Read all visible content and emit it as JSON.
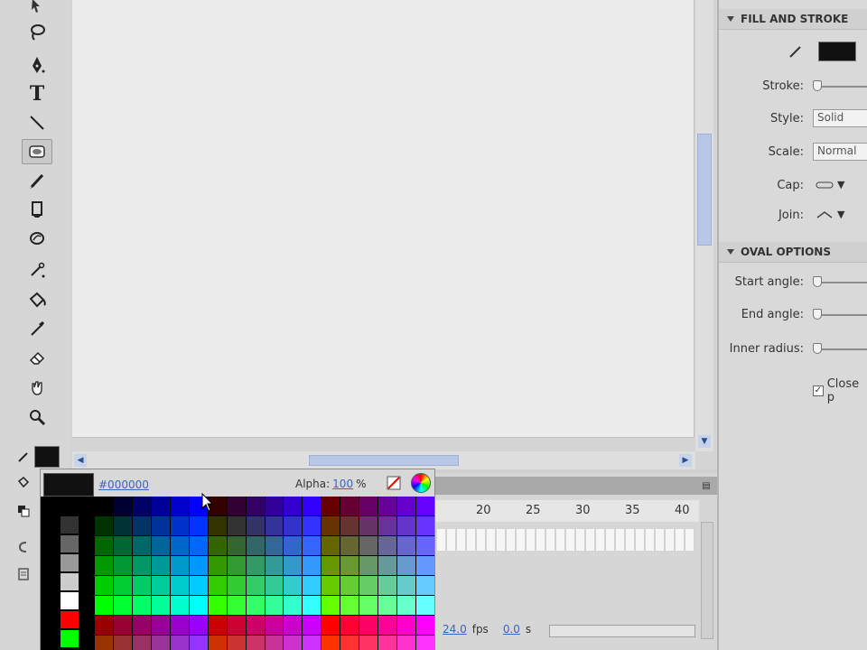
{
  "toolbar": {
    "tools": [
      "lasso-tool",
      "pen-tool",
      "text-tool",
      "line-tool",
      "oval-tool",
      "pencil-tool",
      "brush-tool",
      "deco-tool",
      "bone-tool",
      "paint-bucket-tool",
      "eyedropper-tool",
      "eraser-tool",
      "hand-tool",
      "zoom-tool"
    ],
    "text_tool_glyph": "T",
    "stroke_color": "#111111",
    "selected_tool": "oval-tool"
  },
  "swatch_popup": {
    "hex": "#000000",
    "alpha_label": "Alpha:",
    "alpha_value": "100",
    "alpha_unit": "%",
    "left_column": [
      "#000000",
      "#333333",
      "#666666",
      "#999999",
      "#cccccc",
      "#ffffff",
      "#ff0000",
      "#00ff00"
    ]
  },
  "timeline": {
    "ruler_numbers": [
      "20",
      "25",
      "30",
      "35",
      "40"
    ],
    "fps_value": "24.0",
    "fps_unit": "fps",
    "time_value": "0.0",
    "time_unit": "s"
  },
  "properties": {
    "fill_stroke": {
      "title": "FILL AND STROKE",
      "stroke_label": "Stroke:",
      "style_label": "Style:",
      "style_value": "Solid",
      "scale_label": "Scale:",
      "scale_value": "Normal",
      "cap_label": "Cap:",
      "join_label": "Join:",
      "stroke_color": "#111111"
    },
    "oval_options": {
      "title": "OVAL OPTIONS",
      "start_angle_label": "Start angle:",
      "end_angle_label": "End angle:",
      "inner_radius_label": "Inner radius:",
      "close_path_label": "Close p",
      "close_path_checked": true
    }
  },
  "colors": {
    "canvas_bg": "#ececec",
    "link_blue": "#3a67b8",
    "scroll_thumb": "#b7c8e6"
  }
}
